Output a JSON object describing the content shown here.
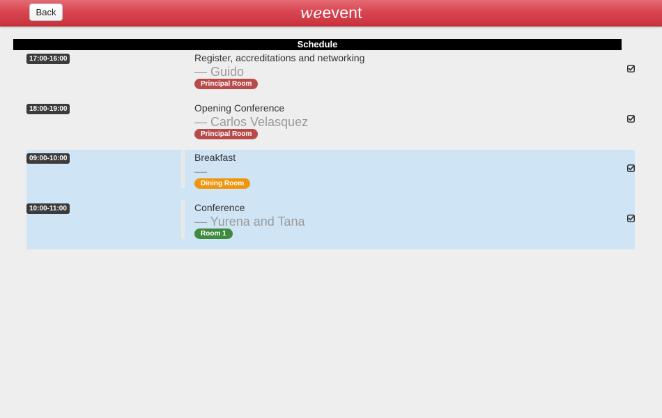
{
  "app": {
    "back_label": "Back",
    "logo_we": "we",
    "logo_event": "event"
  },
  "schedule": {
    "header": "Schedule",
    "items": [
      {
        "time": "17:00-16:00",
        "title": "Register, accreditations and networking",
        "speaker": "— Guido",
        "room": "Principal Room",
        "room_color": "#b84a4a",
        "highlighted": false,
        "icon": "checkbox-icon"
      },
      {
        "time": "18:00-19:00",
        "title": "Opening Conference",
        "speaker": "— Carlos Velasquez",
        "room": "Principal Room",
        "room_color": "#b84a4a",
        "highlighted": false,
        "icon": "checkbox-icon"
      },
      {
        "time": "09:00-10:00",
        "title": "Breakfast",
        "speaker": "—",
        "room": "Dining Room",
        "room_color": "#f0960e",
        "highlighted": true,
        "icon": "checkbox-icon"
      },
      {
        "time": "10:00-11:00",
        "title": "Conference",
        "speaker": "— Yurena and Tana",
        "room": "Room 1",
        "room_color": "#3f8a3f",
        "highlighted": true,
        "icon": "checkbox-icon"
      }
    ]
  },
  "colors": {
    "topbar": "#d84651",
    "highlight_bg": "#cfe5f5",
    "page_bg": "#eeeeee"
  }
}
